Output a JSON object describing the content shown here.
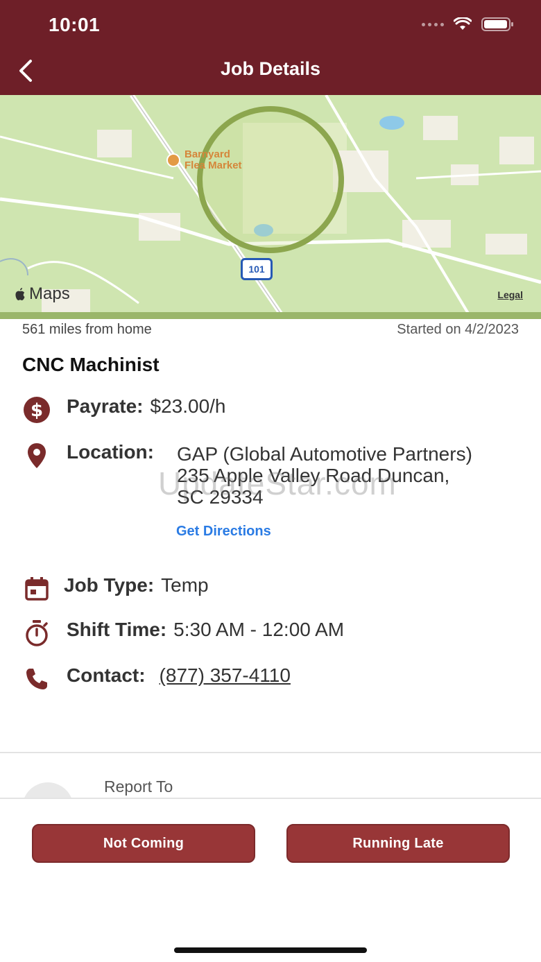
{
  "status_bar": {
    "time": "10:01"
  },
  "header": {
    "title": "Job Details",
    "back_icon": "chevron-left-icon"
  },
  "map": {
    "poi_name_line1": "Barnyard",
    "poi_name_line2": "Flea Market",
    "highway": "101",
    "brand": "Maps",
    "legal": "Legal"
  },
  "job": {
    "distance": "561 miles from home",
    "started": "Started on 4/2/2023",
    "title": "CNC Machinist",
    "payrate_label": "Payrate:",
    "payrate_value": "$23.00/h",
    "location_label": "Location:",
    "location_line1": "GAP (Global Automotive Partners)",
    "location_line2": "235 Apple Valley Road Duncan,",
    "location_line3": "SC 29334",
    "directions": "Get Directions",
    "job_type_label": "Job Type:",
    "job_type_value": "Temp",
    "shift_label": "Shift Time:",
    "shift_value": "5:30 AM - 12:00 AM",
    "contact_label": "Contact:",
    "contact_value": "(877) 357-4110",
    "report_to": "Report To"
  },
  "watermark": "UpdateStar.com",
  "actions": {
    "not_coming": "Not Coming",
    "running_late": "Running Late"
  },
  "colors": {
    "header": "#6e1f28",
    "button": "#983637",
    "icon": "#7a2b2b",
    "link": "#2a7be4"
  }
}
